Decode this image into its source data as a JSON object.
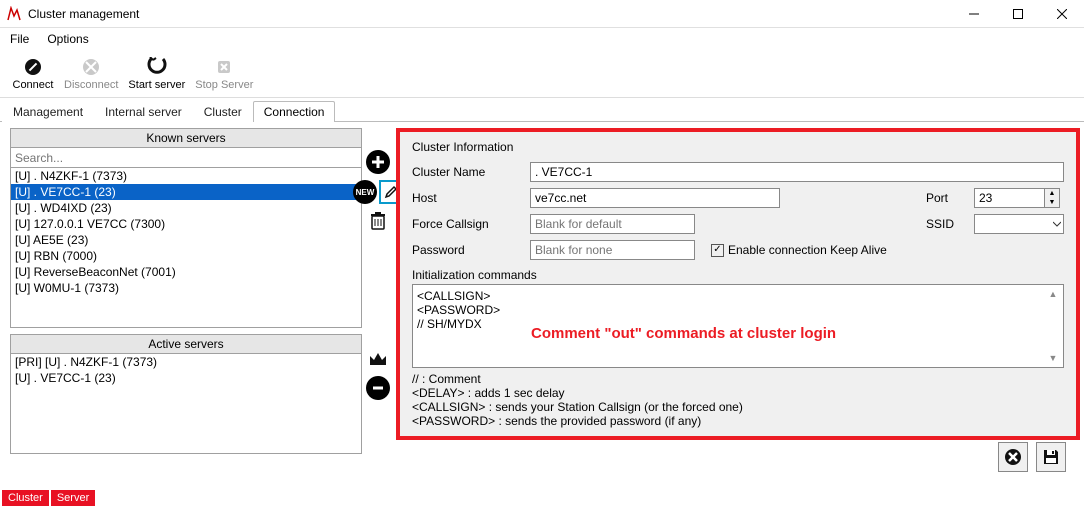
{
  "title": "Cluster management",
  "menu": {
    "file": "File",
    "options": "Options"
  },
  "toolbar": {
    "connect": "Connect",
    "disconnect": "Disconnect",
    "start": "Start server",
    "stop": "Stop Server"
  },
  "tabs": {
    "management": "Management",
    "internal": "Internal server",
    "cluster": "Cluster",
    "connection": "Connection"
  },
  "known": {
    "header": "Known servers",
    "search_placeholder": "Search...",
    "items": [
      "[U] . N4ZKF-1 (7373)",
      "[U] . VE7CC-1 (23)",
      "[U] . WD4IXD (23)",
      "[U] 127.0.0.1 VE7CC (7300)",
      "[U] AE5E (23)",
      "[U] RBN (7000)",
      "[U] ReverseBeaconNet (7001)",
      "[U] W0MU-1 (7373)"
    ],
    "selected_index": 1
  },
  "icons": {
    "new_badge": "NEW"
  },
  "active": {
    "header": "Active servers",
    "items": [
      "[PRI] [U] . N4ZKF-1 (7373)",
      "[U] . VE7CC-1 (23)"
    ]
  },
  "form": {
    "group": "Cluster Information",
    "name_label": "Cluster Name",
    "name_value": ". VE7CC-1",
    "host_label": "Host",
    "host_value": "ve7cc.net",
    "port_label": "Port",
    "port_value": "23",
    "force_label": "Force Callsign",
    "force_placeholder": "Blank for default",
    "ssid_label": "SSID",
    "password_label": "Password",
    "password_placeholder": "Blank for none",
    "keepalive_label": "Enable connection Keep Alive",
    "init_label": "Initialization commands",
    "init_lines": [
      "<CALLSIGN>",
      "<PASSWORD>",
      "// SH/MYDX"
    ],
    "overlay": "Comment \"out\" commands at cluster login",
    "hints": [
      "// : Comment",
      "<DELAY> : adds 1 sec delay",
      "<CALLSIGN> : sends your Station Callsign (or the forced one)",
      "<PASSWORD> : sends the provided password (if any)"
    ]
  },
  "status": {
    "cluster": "Cluster",
    "server": "Server"
  }
}
